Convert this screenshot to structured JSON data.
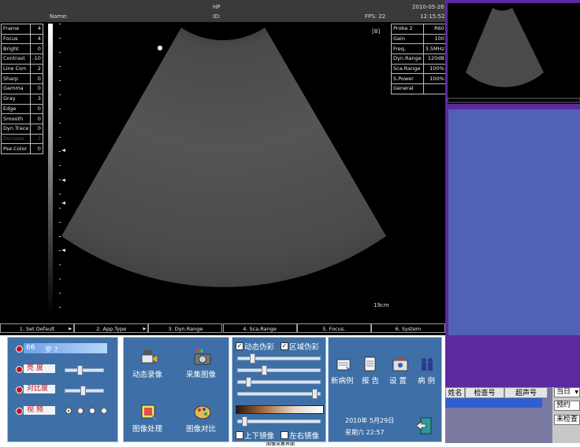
{
  "screen": {
    "hospital": "HP",
    "name_label": "Name:",
    "id_label": "ID:",
    "fps": "FPS: 22",
    "date": "2010-05-26",
    "time": "12:15:52",
    "zoom_tag": "[B]",
    "depth": "19cm"
  },
  "params": [
    {
      "label": "Frame",
      "value": "4"
    },
    {
      "label": "Focus",
      "value": "4"
    },
    {
      "label": "Bright",
      "value": "0"
    },
    {
      "label": "Contrast",
      "value": "-10"
    },
    {
      "label": "Line Corr.",
      "value": "2"
    },
    {
      "label": "Sharp",
      "value": "0"
    },
    {
      "label": "Gamma",
      "value": "0"
    },
    {
      "label": "Gray",
      "value": "3"
    },
    {
      "label": "Edge",
      "value": "0"
    },
    {
      "label": "Smooth",
      "value": "0"
    },
    {
      "label": "Dyn.Trace",
      "value": "0"
    },
    {
      "label": "Denoise",
      "value": "2"
    },
    {
      "label": "Pse.Color",
      "value": "0"
    }
  ],
  "probe": [
    {
      "label": "Probe 2",
      "value": "R60"
    },
    {
      "label": "Gain",
      "value": "100"
    },
    {
      "label": "Freq.",
      "value": "3.5MHz"
    },
    {
      "label": "Dyn.Range",
      "value": "120dB"
    },
    {
      "label": "Sca.Range",
      "value": "100%"
    },
    {
      "label": "S.Power",
      "value": "100%"
    },
    {
      "label": "General",
      "value": ""
    }
  ],
  "softkeys": [
    "1. Set Default",
    "2. App.Type",
    "3. Dyn.Range",
    "4. Sca.Range",
    "5. Focus.",
    "6. System"
  ],
  "left_panel": {
    "age_value": "66",
    "age_unit": "岁 ?",
    "brightness": "亮  度",
    "contrast": "对比度",
    "video": "视  频"
  },
  "left_panel_levels": {
    "brightness": 0.35,
    "contrast": 0.45,
    "video_selected": 0
  },
  "actions": {
    "record": "动态录像",
    "capture": "采集图像",
    "process": "图像处理",
    "compare": "图像对比"
  },
  "options": {
    "dynamic_artifact": "动态伪彩",
    "region_artifact": "区域伪彩",
    "flip_vertical": "上下镜像",
    "flip_horizontal": "左右镜像",
    "dynamic_checked": true,
    "region_checked": true,
    "flip_v_checked": false,
    "flip_h_checked": false
  },
  "option_sliders": [
    0.15,
    0.3,
    0.1,
    0.95,
    0.05
  ],
  "nav": {
    "new_case": "新病例",
    "report": "报  告",
    "settings": "设  置",
    "cases": "病  例",
    "date": "2010年  5月29日",
    "weekday_time": "星期六  22:57"
  },
  "patient_grid": {
    "columns": [
      "姓名",
      "检查号",
      "超声号"
    ]
  },
  "filters": {
    "period": "当日",
    "scheduled": "预约",
    "unchecked": "未检查"
  },
  "footer_label": "图像采集界面",
  "colors": {
    "panel": "#3e6fa6",
    "purple": "#5b2a9e",
    "tile": "#5161b4"
  }
}
